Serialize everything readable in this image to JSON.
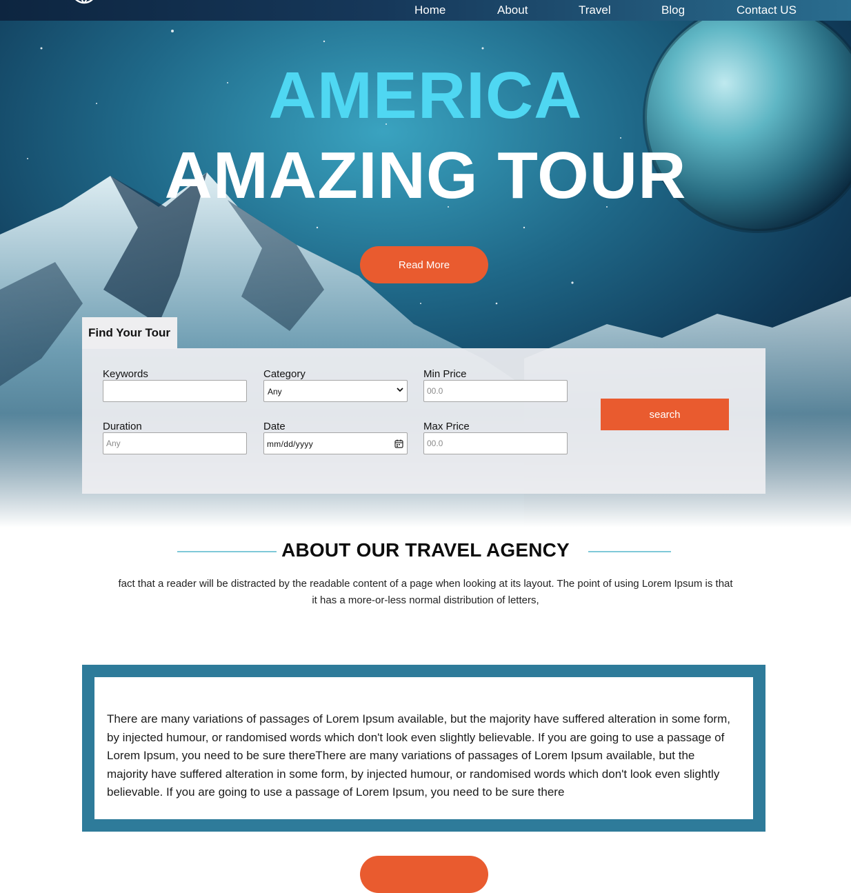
{
  "nav": {
    "logo_icon": "globe-icon",
    "items": [
      {
        "label": "Home"
      },
      {
        "label": "About"
      },
      {
        "label": "Travel"
      },
      {
        "label": "Blog"
      },
      {
        "label": "Contact US"
      }
    ]
  },
  "hero": {
    "title_line_1": "AMERICA",
    "title_line_2": "AMAZING TOUR",
    "cta_label": "Read More",
    "accent_color": "#4fd7f2",
    "button_color": "#e95b2f"
  },
  "search": {
    "tab_label": "Find Your Tour",
    "keywords_label": "Keywords",
    "keywords_value": "",
    "category_label": "Category",
    "category_value": "Any",
    "min_price_label": "Min Price",
    "min_price_placeholder": "00.0",
    "duration_label": "Duration",
    "duration_placeholder": "Any",
    "date_label": "Date",
    "date_value": "mm/dd/yyyy",
    "max_price_label": "Max Price",
    "max_price_placeholder": "00.0",
    "button_label": "search"
  },
  "about": {
    "title": "ABOUT OUR TRAVEL AGENCY",
    "text": "fact that a reader will be distracted by the readable content of a page when looking at its layout. The point of using Lorem Ipsum is that it has a more-or-less normal distribution of letters,"
  },
  "box": {
    "text": "There are many variations of passages of Lorem Ipsum available, but the majority have suffered alteration in some form, by injected humour, or randomised words which don't look even slightly believable. If you are going to use a passage of Lorem Ipsum, you need to be sure thereThere are many variations of passages of Lorem Ipsum available, but the majority have suffered alteration in some form, by injected humour, or randomised words which don't look even slightly believable. If you are going to use a passage of Lorem Ipsum, you need to be sure there",
    "border_color": "#2e7b9a"
  }
}
